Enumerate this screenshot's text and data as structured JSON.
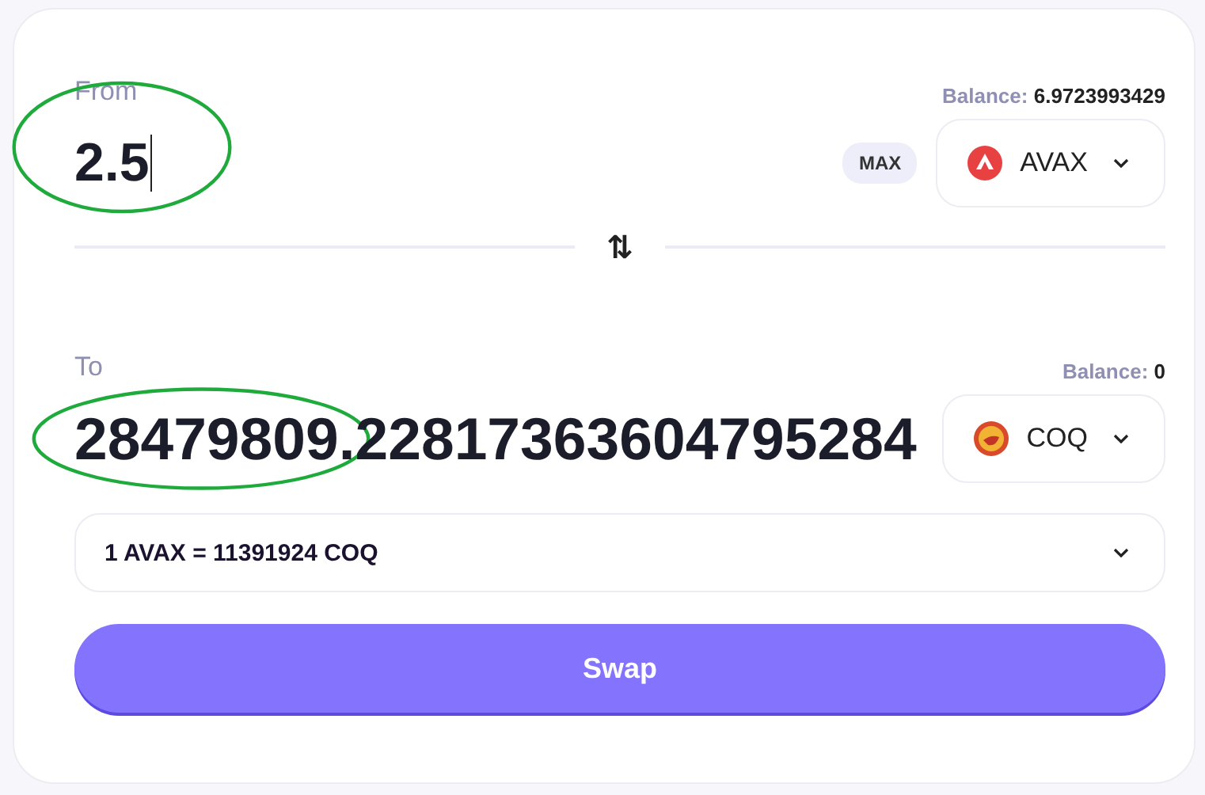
{
  "from": {
    "label": "From",
    "balance_label": "Balance:",
    "balance": "6.9723993429",
    "amount": "2.5",
    "highlighted": true,
    "max": "MAX",
    "token": "AVAX",
    "kind": "avax"
  },
  "swap_direction": "⇅",
  "to": {
    "label": "To",
    "balance_label": "Balance:",
    "balance": "0",
    "amount": "28479809.22817363604795284",
    "highlighted": true,
    "token": "COQ",
    "kind": "coq"
  },
  "rate": "1 AVAX = 11391924 COQ",
  "button": "Swap"
}
